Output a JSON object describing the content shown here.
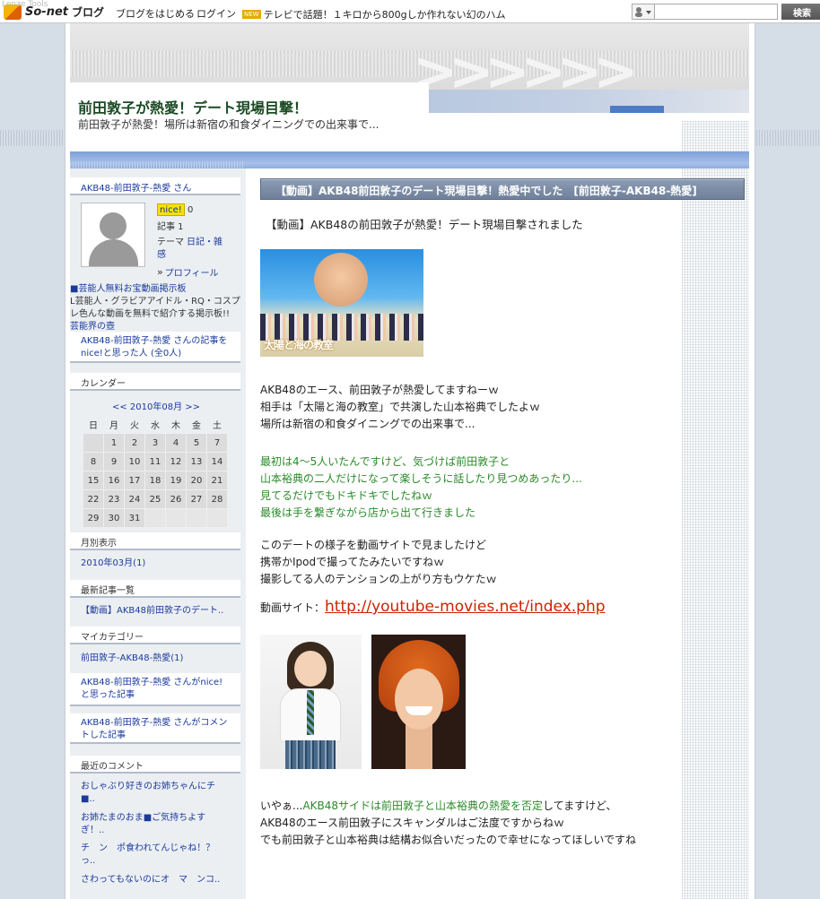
{
  "global_header": {
    "overlay_text": "Lenze Tools",
    "brand": "So-net",
    "blog_label": "ブログ",
    "links": [
      "ブログをはじめる",
      "ログイン"
    ],
    "ad_badge": "NEW",
    "ad_text": "テレビで話題！１キロから800gしか作れない幻のハム",
    "search_placeholder": "",
    "search_button": "検索"
  },
  "blog": {
    "title": "前田敦子が熱愛！デート現場目撃！",
    "subtitle": "前田敦子が熱愛！場所は新宿の和食ダイニングでの出来事で..."
  },
  "sidebar": {
    "profile_header": "AKB48-前田敦子-熱愛 さん",
    "nice_badge": "nice!",
    "nice_count": "0",
    "articles": "記事 1",
    "theme_label": "テーマ",
    "theme_value": "日記・雑感",
    "profile_link": "プロフィール",
    "promo_title": "■芸能人無料お宝動画掲示板",
    "promo_text": "L芸能人・グラビアアイドル・RQ・コスプレ色んな動画を無料で紹介する掲示板!!",
    "promo_link": "芸能界の壺",
    "nice_people": "AKB48-前田敦子-熱愛 さんの記事をnice!と思った人 (全0人)",
    "calendar_header": "カレンダー",
    "calendar_nav": "<< 2010年08月 >>",
    "calendar_days": [
      "日",
      "月",
      "火",
      "水",
      "木",
      "金",
      "土"
    ],
    "calendar_weeks": [
      [
        "",
        "1",
        "2",
        "3",
        "4",
        "5",
        "7"
      ],
      [
        "8",
        "9",
        "10",
        "11",
        "12",
        "13",
        "14"
      ],
      [
        "15",
        "16",
        "17",
        "18",
        "19",
        "20",
        "21"
      ],
      [
        "22",
        "23",
        "24",
        "25",
        "26",
        "27",
        "28"
      ],
      [
        "29",
        "30",
        "31",
        "",
        "",
        "",
        ""
      ]
    ],
    "monthly_header": "月別表示",
    "monthly_item": "2010年03月(1)",
    "recent_header": "最新記事一覧",
    "recent_item": "【動画】AKB48前田敦子のデート..",
    "category_header": "マイカテゴリー",
    "category_item": "前田敦子-AKB48-熱愛(1)",
    "nice_articles": "AKB48-前田敦子-熱愛 さんがnice!と思った記事",
    "commented_articles": "AKB48-前田敦子-熱愛 さんがコメントした記事",
    "comments_header": "最近のコメント",
    "comments": [
      "おしゃぶり好きのお姉ちゃんにチ■..",
      "お姉たまのおま■ご気持ちよすぎ！..",
      "チ　ン　ポ食われてんじゃね！？っ..",
      "さわってもないのにオ　マ　ンコ.."
    ]
  },
  "post": {
    "header": "【動画】AKB48前田敦子のデート現場目撃！熱愛中でした　[前田敦子-AKB48-熱愛]",
    "lead": "【動画】AKB48の前田敦子が熱愛！デート現場目撃されました",
    "image1_caption": "太陽と海の教室",
    "para1": [
      "AKB48のエース、前田敦子が熱愛してますねーｗ",
      "相手は「太陽と海の教室」で共演した山本裕典でしたよｗ",
      "場所は新宿の和食ダイニングでの出来事で..."
    ],
    "para2": [
      "最初は4～5人いたんですけど、気づけば前田敦子と",
      "山本裕典の二人だけになって楽しそうに話したり見つめあったり...",
      "見てるだけでもドキドキでしたねｗ",
      "最後は手を繋ぎながら店から出て行きました"
    ],
    "para3": [
      "このデートの様子を動画サイトで見ましたけど",
      "携帯かIpodで撮ってたみたいですねｗ",
      "撮影してる人のテンションの上がり方もウケたｗ"
    ],
    "video_label": "動画サイト：",
    "video_url": "http://youtube-movies.net/index.php",
    "final_1_prefix": "いやぁ...",
    "final_1_green": "AKB48サイドは前田敦子と山本裕典の熱愛を否定",
    "final_1_suffix": "してますけど、",
    "final_2": "AKB48のエース前田敦子にスキャンダルはご法度ですからねｗ",
    "final_3": "でも前田敦子と山本裕典は結構お似合いだったので幸せになってほしいですね"
  }
}
